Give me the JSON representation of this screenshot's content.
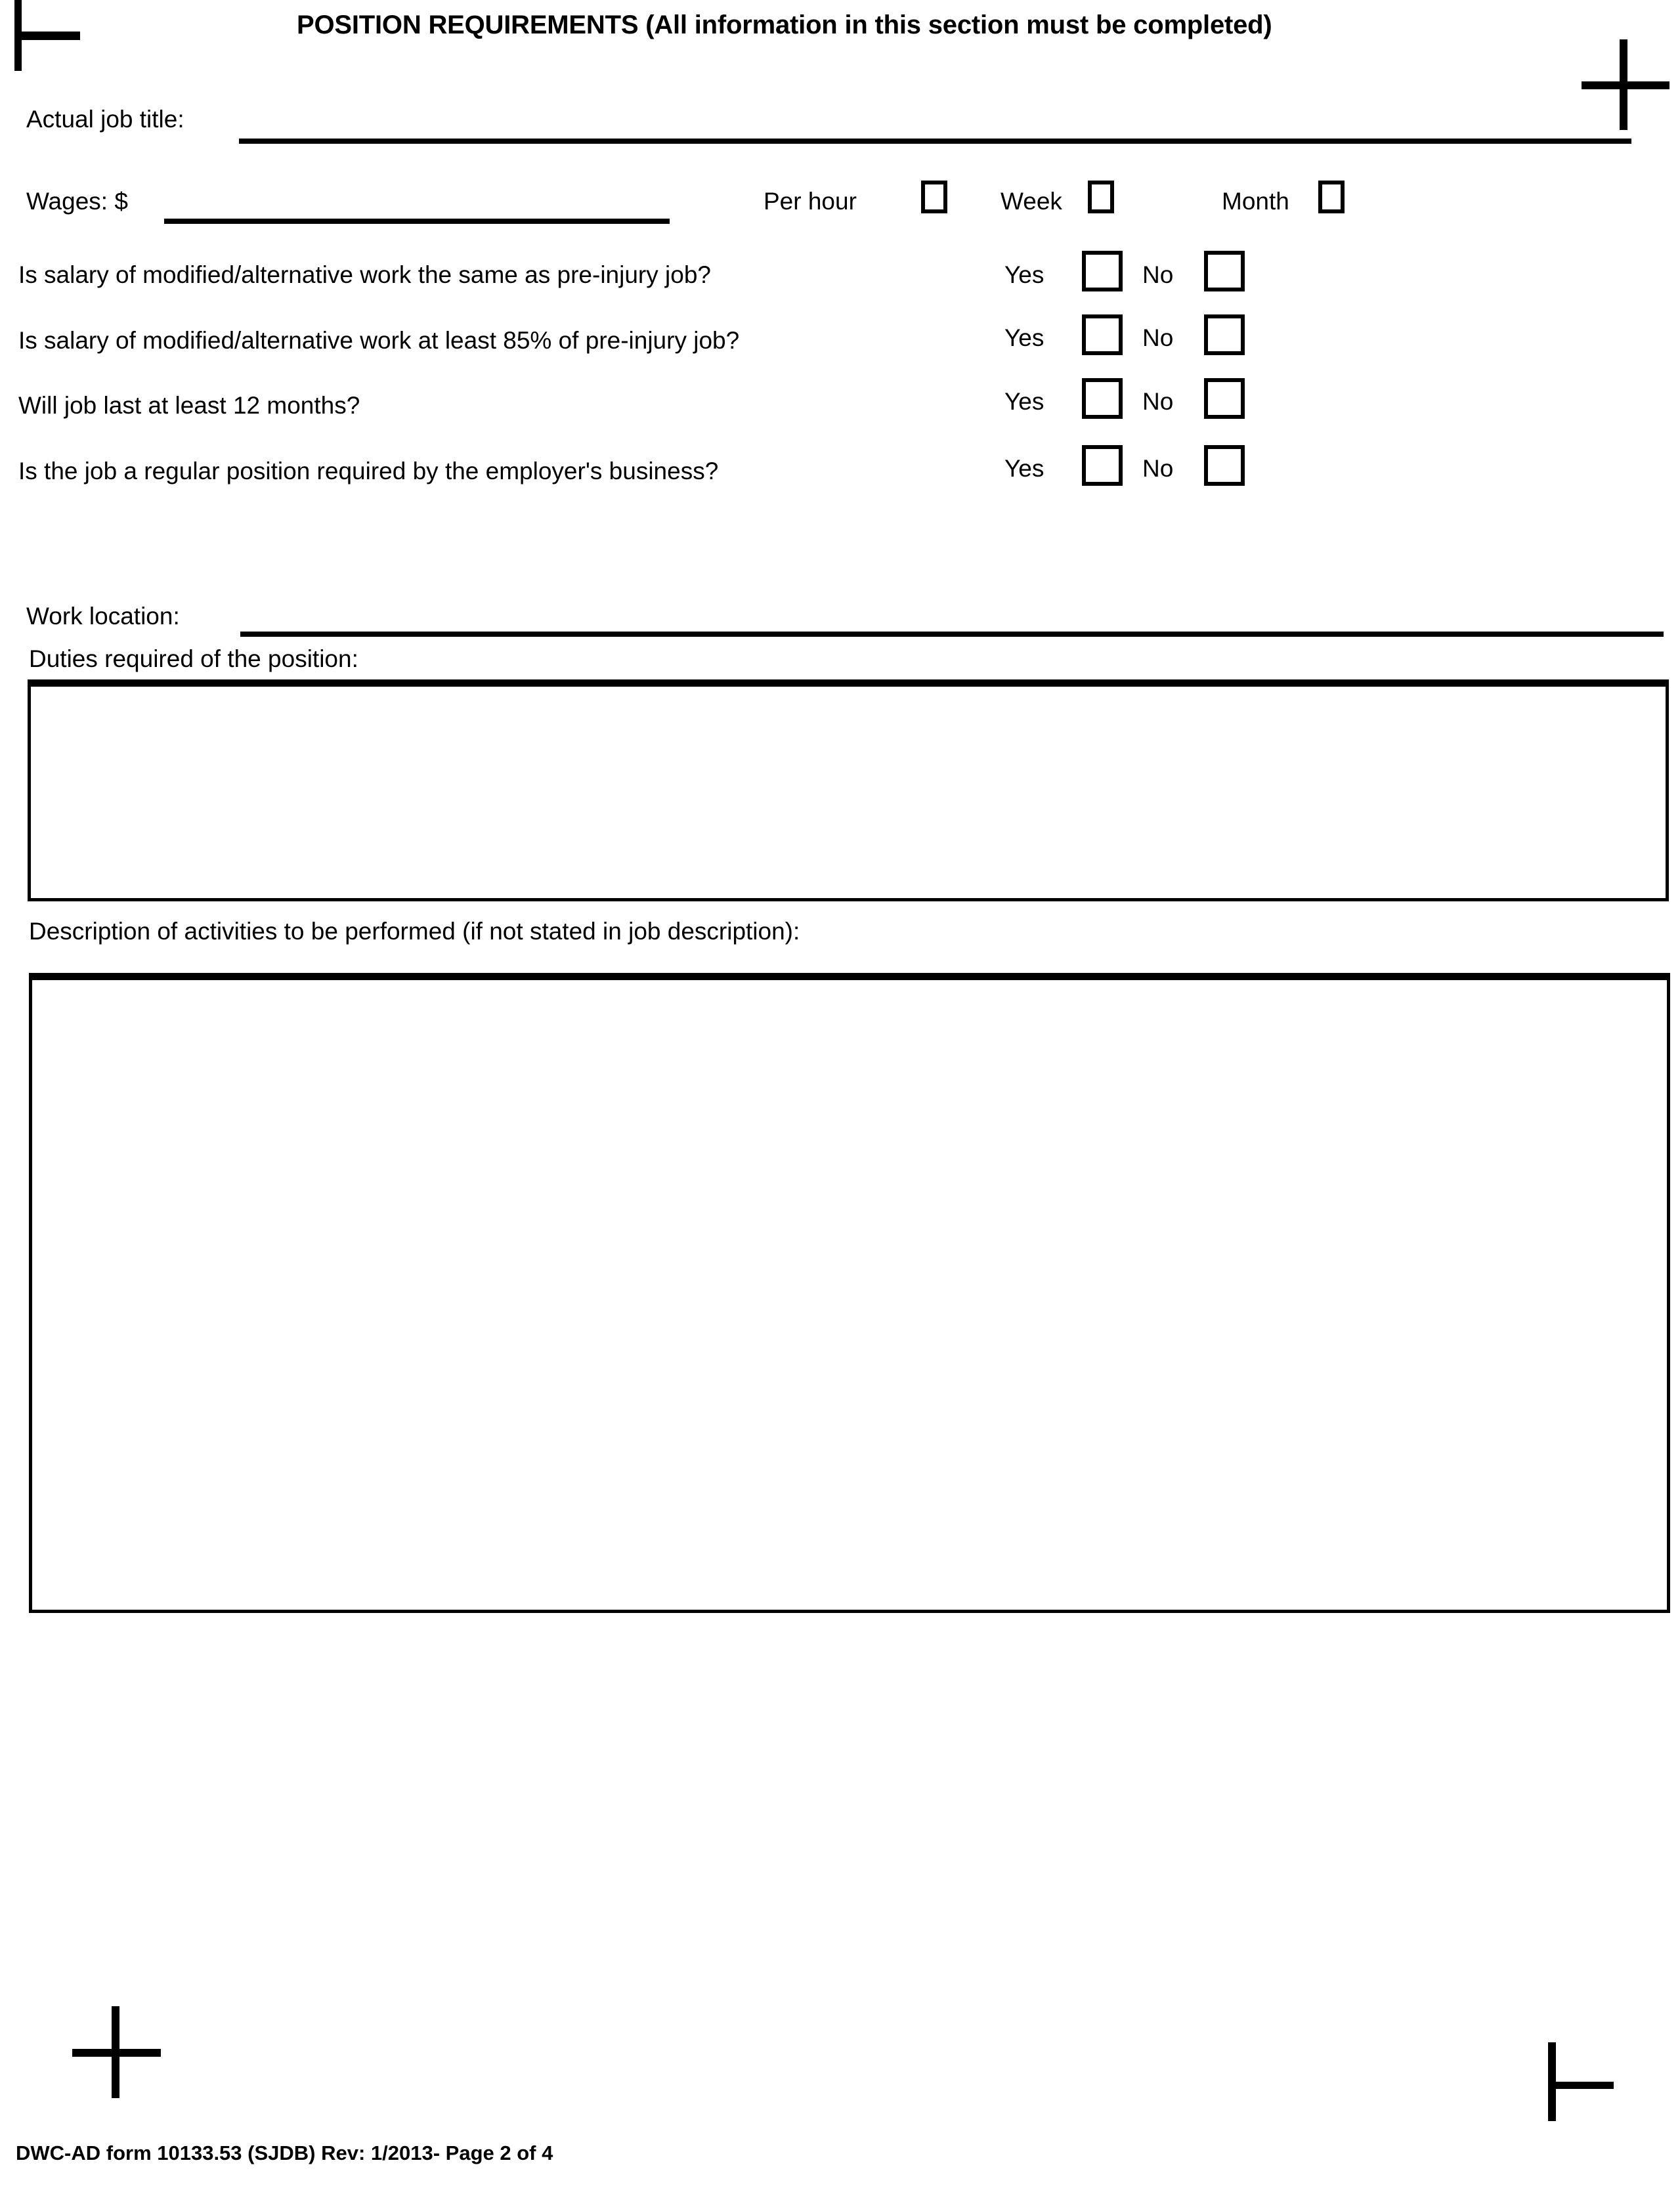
{
  "document": {
    "section_title": "POSITION REQUIREMENTS (All information in this section must be completed)",
    "footer": "DWC-AD form 10133.53 (SJDB) Rev: 1/2013- Page 2 of 4"
  },
  "fields": {
    "job_title_label": "Actual job title:",
    "wages_label": "Wages:  $",
    "work_location_label": "Work location:",
    "duties_label": "Duties required of the position:",
    "activities_label": "Description of activities to be performed (if not stated in job description):",
    "job_title_value": "",
    "wages_value": "",
    "work_location_value": "",
    "duties_value": "",
    "activities_value": ""
  },
  "wage_period": {
    "options": [
      {
        "label": "Per hour",
        "checked": false
      },
      {
        "label": "Week",
        "checked": false
      },
      {
        "label": "Month",
        "checked": false
      }
    ]
  },
  "questions": [
    {
      "text": "Is salary of modified/alternative work the same as pre-injury job?",
      "yes_label": "Yes",
      "no_label": "No",
      "answer": ""
    },
    {
      "text": "Is salary of modified/alternative work at least 85% of pre-injury job?",
      "yes_label": "Yes",
      "no_label": "No",
      "answer": ""
    },
    {
      "text": "Will job last at least 12 months?",
      "yes_label": "Yes",
      "no_label": "No",
      "answer": ""
    },
    {
      "text": "Is the job a regular position required by the employer's business?",
      "yes_label": "Yes",
      "no_label": "No",
      "answer": ""
    }
  ]
}
